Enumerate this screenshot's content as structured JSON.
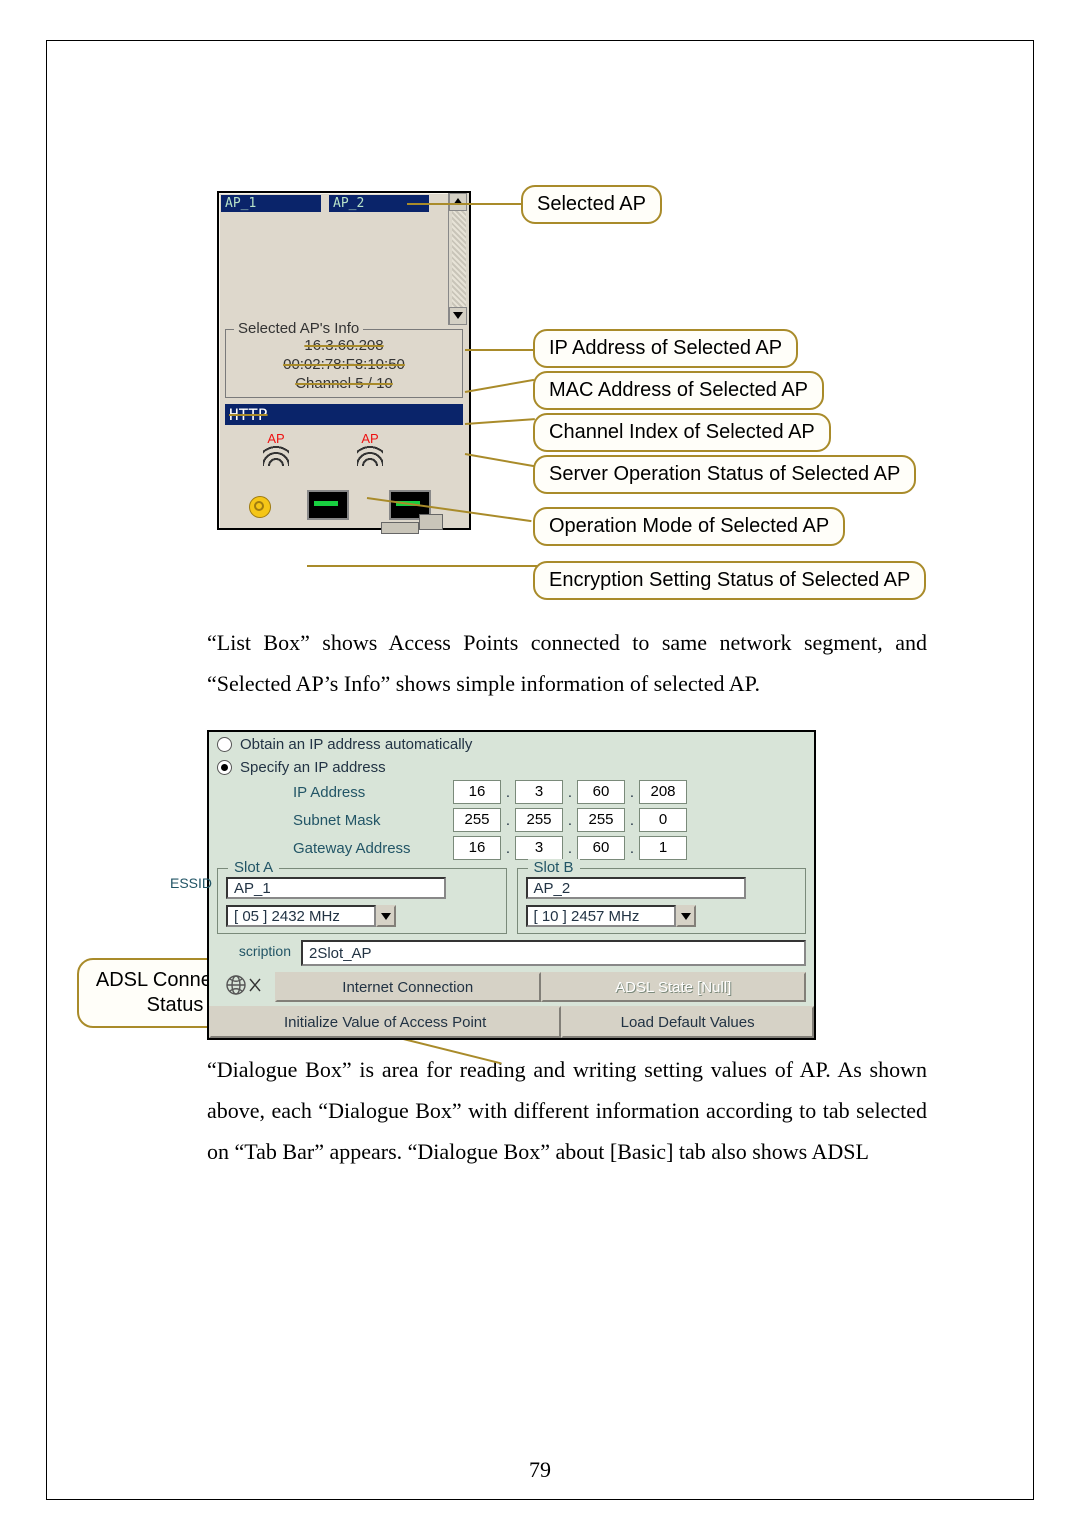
{
  "panel": {
    "ap1": "AP_1",
    "ap2": "AP_2",
    "info_legend": "Selected AP's Info",
    "ip": "16.3.60.208",
    "mac": "00:02:78:F8:10:50",
    "channel": "Channel 5 / 10",
    "http": "HTTP",
    "ap_label": "AP"
  },
  "callouts": {
    "c1": "Selected AP",
    "c2": "IP Address of Selected AP",
    "c3": "MAC Address of Selected AP",
    "c4": "Channel Index of Selected AP",
    "c5": "Server Operation Status of Selected AP",
    "c6": "Operation Mode of Selected AP",
    "c7": "Encryption Setting Status of Selected AP"
  },
  "para1": "“List Box” shows Access Points connected to same network segment, and “Selected AP’s Info” shows simple information of selected AP.",
  "dlg": {
    "radio1": "Obtain an IP address automatically",
    "radio2": "Specify an IP address",
    "ip_label": "IP Address",
    "ip": [
      "16",
      "3",
      "60",
      "208"
    ],
    "sm_label": "Subnet Mask",
    "sm": [
      "255",
      "255",
      "255",
      "0"
    ],
    "gw_label": "Gateway Address",
    "gw": [
      "16",
      "3",
      "60",
      "1"
    ],
    "slotA": "Slot A",
    "slotB": "Slot B",
    "essid_label": "ESSID",
    "slotA_essid": "AP_1",
    "slotB_essid": "AP_2",
    "slotA_ch": "[ 05 ] 2432 MHz",
    "slotB_ch": "[ 10 ] 2457 MHz",
    "desc_label": "scription",
    "desc": "2Slot_AP",
    "ic_btn": "Internet Connection",
    "adsl_state": "ADSL State [Null]",
    "init_btn": "Initialize Value of Access Point",
    "load_btn": "Load Default Values",
    "adsl_co": "ADSL Connection Status"
  },
  "para2": "“Dialogue Box” is area for reading and writing setting values of AP. As shown above, each “Dialogue Box” with different information according to tab selected on “Tab Bar” appears. “Dialogue Box” about [Basic] tab also shows ADSL",
  "pagenum": "79"
}
